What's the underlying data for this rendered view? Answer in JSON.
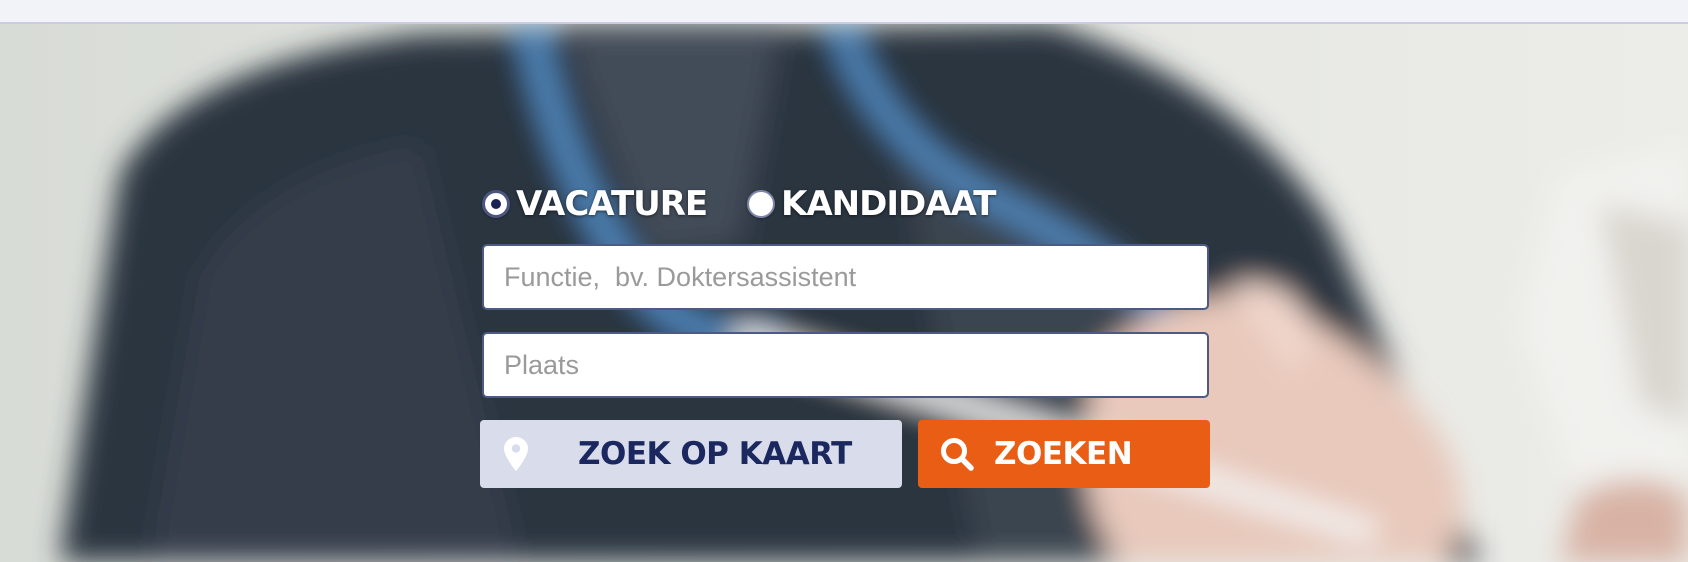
{
  "colors": {
    "accent_orange": "#e95e14",
    "navy_text": "#1b2860",
    "map_button_bg": "#d9dcea",
    "top_bar": "#f2f3f8"
  },
  "search": {
    "type_options": [
      {
        "label": "VACATURE",
        "selected": true
      },
      {
        "label": "KANDIDAAT",
        "selected": false
      }
    ],
    "functie": {
      "placeholder": "Functie,  bv. Doktersassistent",
      "value": ""
    },
    "plaats": {
      "placeholder": "Plaats",
      "value": ""
    },
    "map_button": {
      "label": "ZOEK OP KAART",
      "icon": "map-pin-icon"
    },
    "search_button": {
      "label": "ZOEKEN",
      "icon": "magnifier-icon"
    }
  }
}
